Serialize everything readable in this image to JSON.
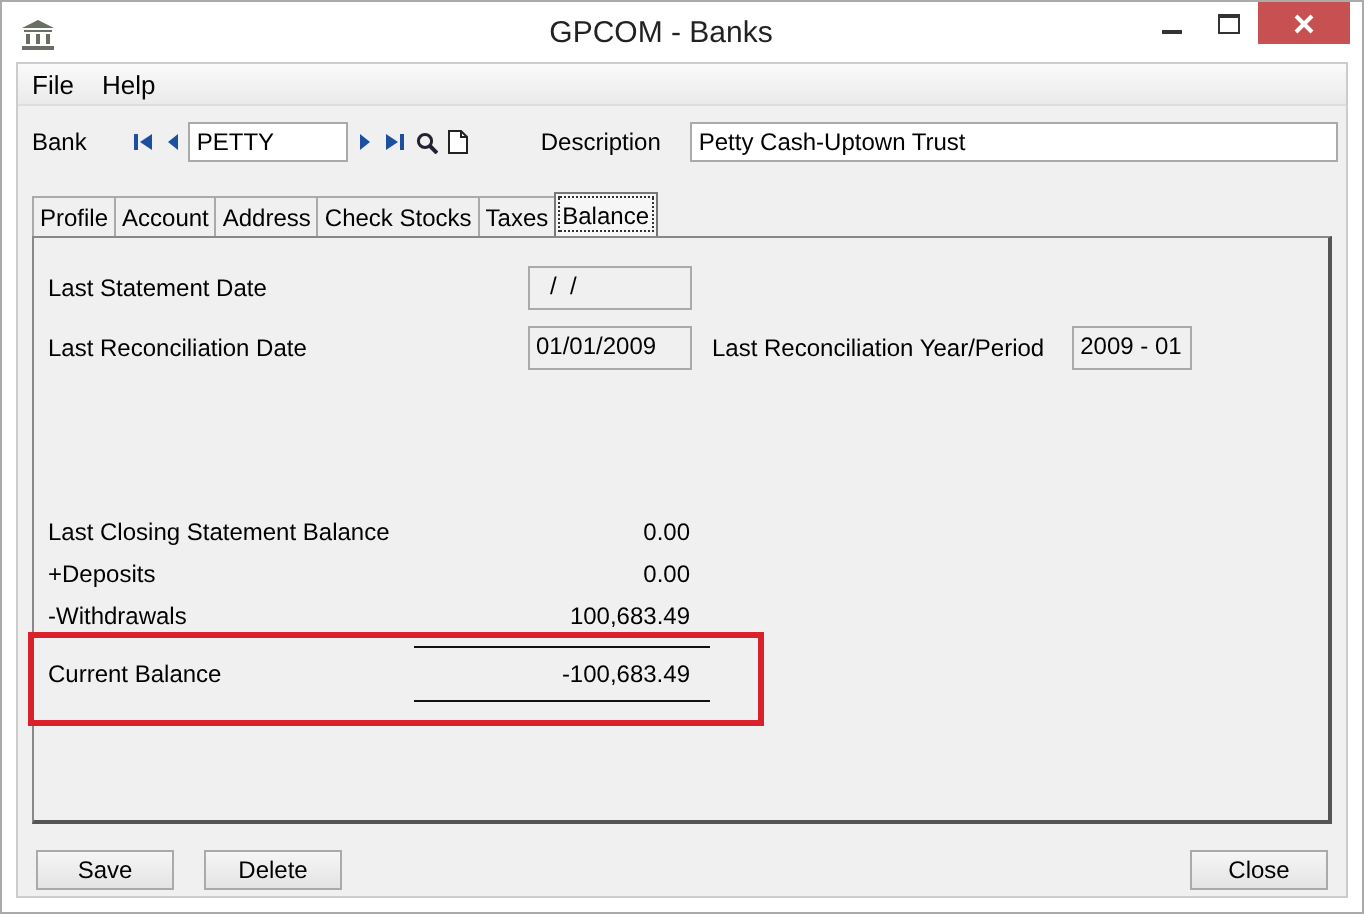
{
  "window": {
    "title": "GPCOM - Banks"
  },
  "menu": [
    {
      "label": "File"
    },
    {
      "label": "Help"
    }
  ],
  "bank": {
    "label": "Bank",
    "value": "PETTY"
  },
  "description": {
    "label": "Description",
    "value": "Petty Cash-Uptown Trust"
  },
  "tabs": [
    {
      "label": "Profile",
      "selected": false
    },
    {
      "label": "Account",
      "selected": false
    },
    {
      "label": "Address",
      "selected": false
    },
    {
      "label": "Check Stocks",
      "selected": false
    },
    {
      "label": "Taxes",
      "selected": false
    },
    {
      "label": "Balance",
      "selected": true
    }
  ],
  "dates": [
    {
      "label": "Last Statement Date",
      "value": "/  /"
    },
    {
      "label": "Last Reconciliation Date",
      "value": "01/01/2009"
    }
  ],
  "period": {
    "label": "Last Reconciliation Year/Period",
    "value": "2009 - 01"
  },
  "balances": [
    {
      "label": "Last Closing Statement Balance",
      "value": "0.00"
    },
    {
      "label": "+Deposits",
      "value": "0.00"
    },
    {
      "label": "-Withdrawals",
      "value": "100,683.49"
    }
  ],
  "current_balance": {
    "label": "Current Balance",
    "value": "-100,683.49"
  },
  "buttons": [
    {
      "label": "Save"
    },
    {
      "label": "Delete"
    }
  ],
  "close_button": {
    "label": "Close"
  }
}
